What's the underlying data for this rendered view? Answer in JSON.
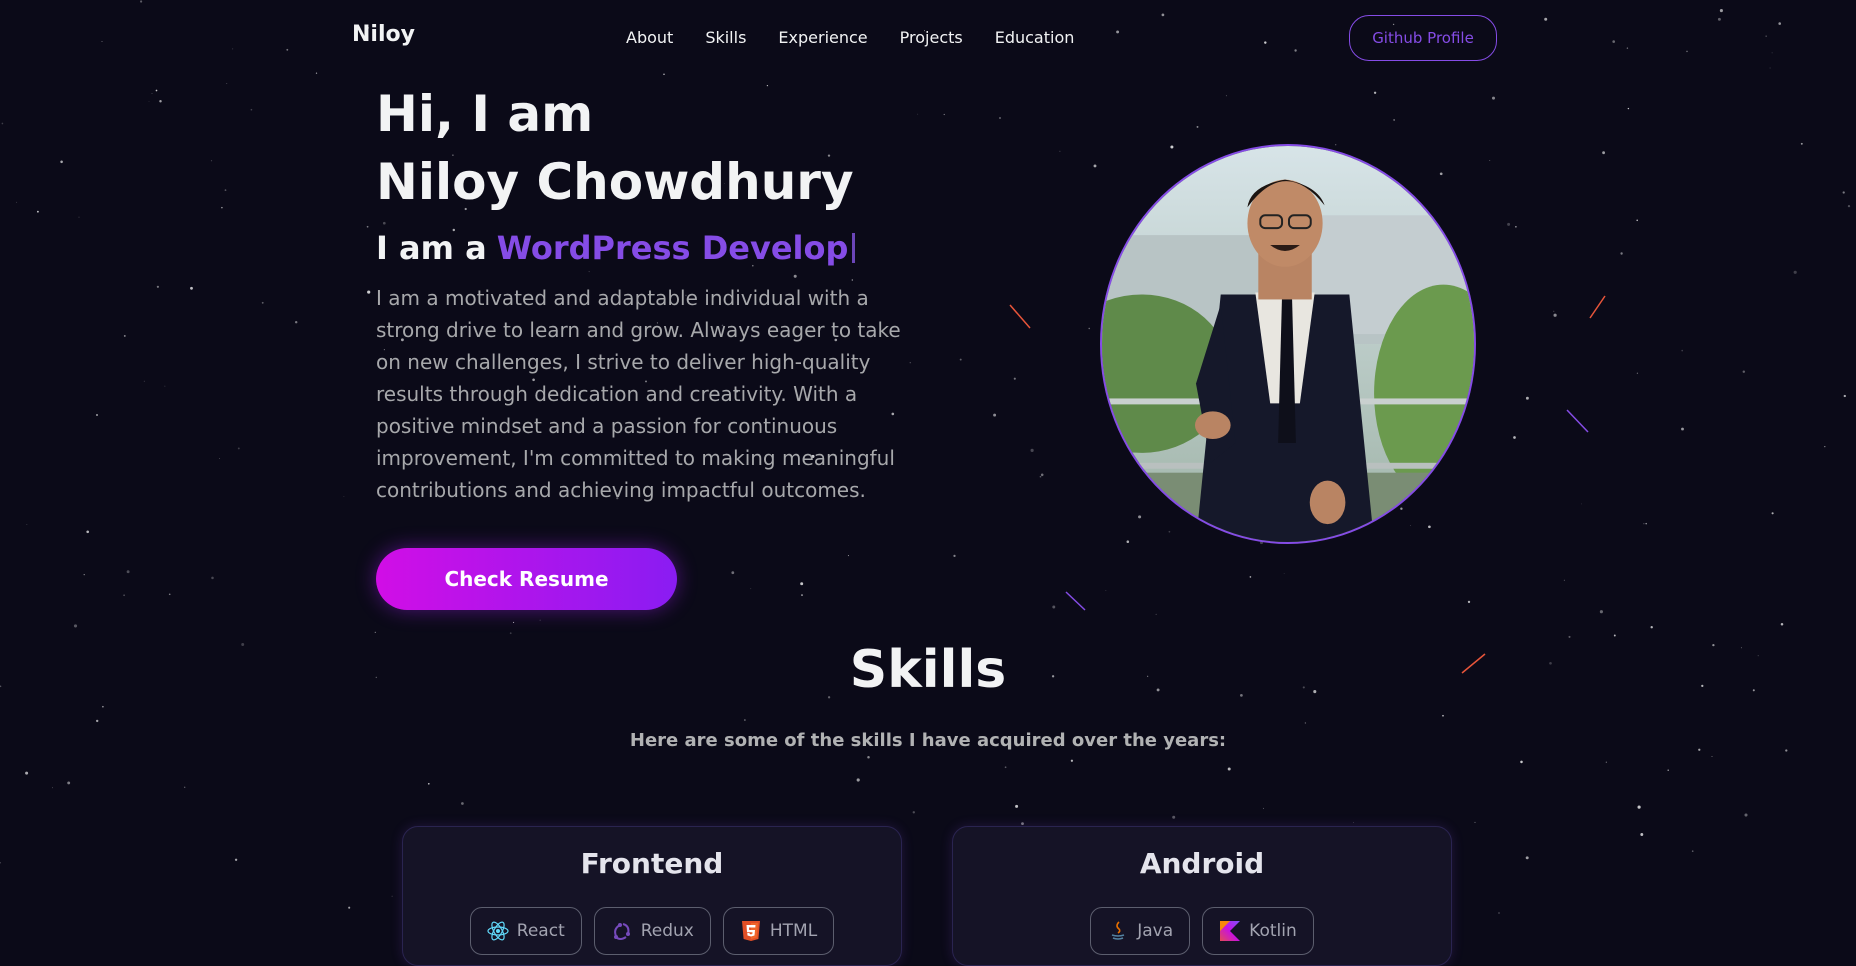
{
  "nav": {
    "brand": "Niloy",
    "links": [
      "About",
      "Skills",
      "Experience",
      "Projects",
      "Education"
    ],
    "github_label": "Github Profile"
  },
  "hero": {
    "title_line1": "Hi, I am",
    "title_line2": "Niloy Chowdhury",
    "role_prefix": "I am a",
    "role_typed": "WordPress Develop",
    "description": "I am a motivated and adaptable individual with a strong drive to learn and grow. Always eager to take on new challenges, I strive to deliver high-quality results through dedication and creativity. With a positive mindset and a passion for continuous improvement, I'm committed to making meaningful contributions and achieving impactful outcomes.",
    "resume_label": "Check Resume"
  },
  "skills": {
    "title": "Skills",
    "subtitle": "Here are some of the skills I have acquired over the years:",
    "cards": [
      {
        "title": "Frontend",
        "chips": [
          {
            "label": "React",
            "icon": "react-icon"
          },
          {
            "label": "Redux",
            "icon": "redux-icon"
          },
          {
            "label": "HTML",
            "icon": "html5-icon"
          }
        ]
      },
      {
        "title": "Android",
        "chips": [
          {
            "label": "Java",
            "icon": "java-icon"
          },
          {
            "label": "Kotlin",
            "icon": "kotlin-icon"
          }
        ]
      }
    ]
  },
  "colors": {
    "background": "#0b0a18",
    "accent": "#854ce6",
    "text_primary": "#f2f3f4",
    "text_secondary": "#a7a8ab",
    "button_gradient_start": "#d10ee6",
    "button_gradient_end": "#8a1cf2"
  }
}
